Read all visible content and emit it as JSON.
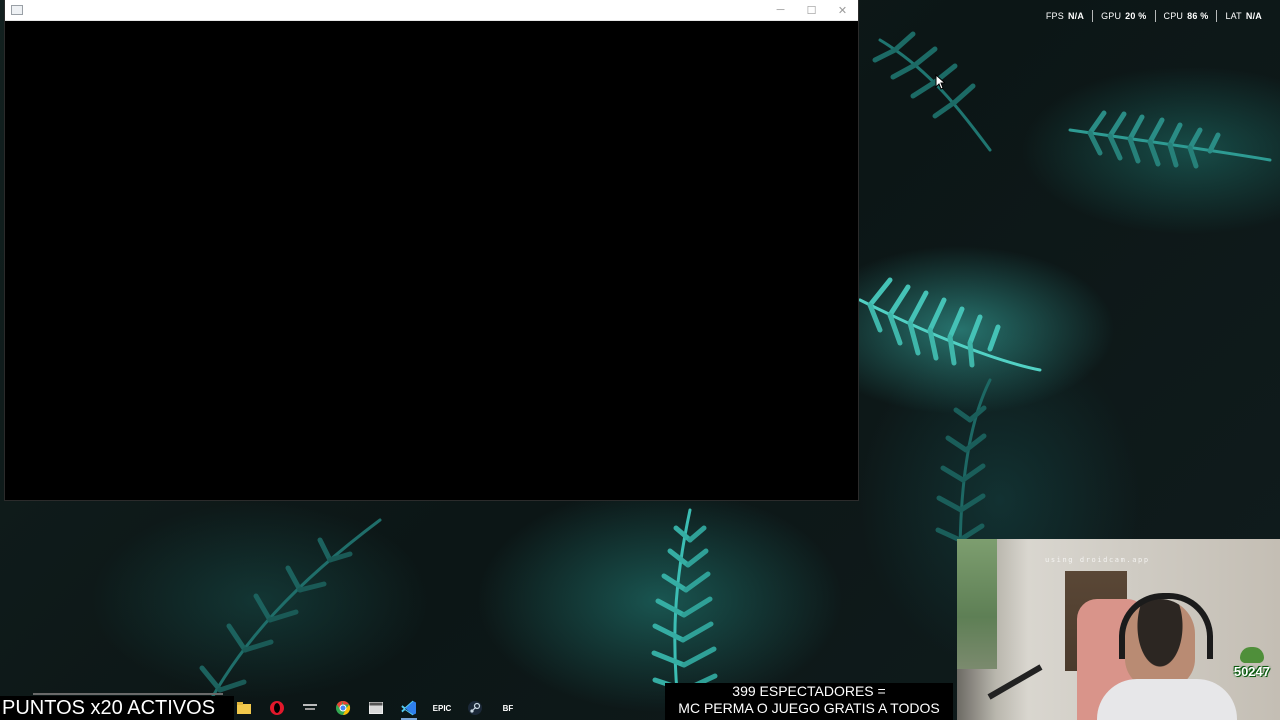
{
  "performance_overlay": {
    "items": [
      {
        "label": "FPS",
        "value": "N/A"
      },
      {
        "label": "GPU",
        "value": "20 %"
      },
      {
        "label": "CPU",
        "value": "86 %"
      },
      {
        "label": "LAT",
        "value": "N/A"
      }
    ]
  },
  "window": {
    "title": "",
    "controls": {
      "minimize": "─",
      "maximize": "☐",
      "close": "✕"
    }
  },
  "taskbar": {
    "points_text": "PUNTOS x20 ACTIVOS",
    "icons": [
      {
        "name": "file-explorer-icon",
        "active": false
      },
      {
        "name": "opera-gx-icon",
        "active": false
      },
      {
        "name": "lunar-client-icon",
        "active": false
      },
      {
        "name": "chrome-icon",
        "active": false
      },
      {
        "name": "app-window-icon",
        "active": false
      },
      {
        "name": "vscode-icon",
        "active": true
      },
      {
        "name": "epic-games-icon",
        "active": false
      },
      {
        "name": "steam-icon",
        "active": false
      },
      {
        "name": "bf-icon",
        "active": false,
        "text": "BF"
      }
    ],
    "epic_text": "EPIC",
    "bf_text": "BF"
  },
  "stream": {
    "viewers_line1": "399 ESPECTADORES =",
    "viewers_line2": "MC PERMA O JUEGO GRATIS A TODOS",
    "webcam_watermark": "using droidcam.app",
    "counter": "50247"
  },
  "colors": {
    "accent_teal": "#3cbeb4",
    "taskbar_active": "#7aa5d6"
  }
}
